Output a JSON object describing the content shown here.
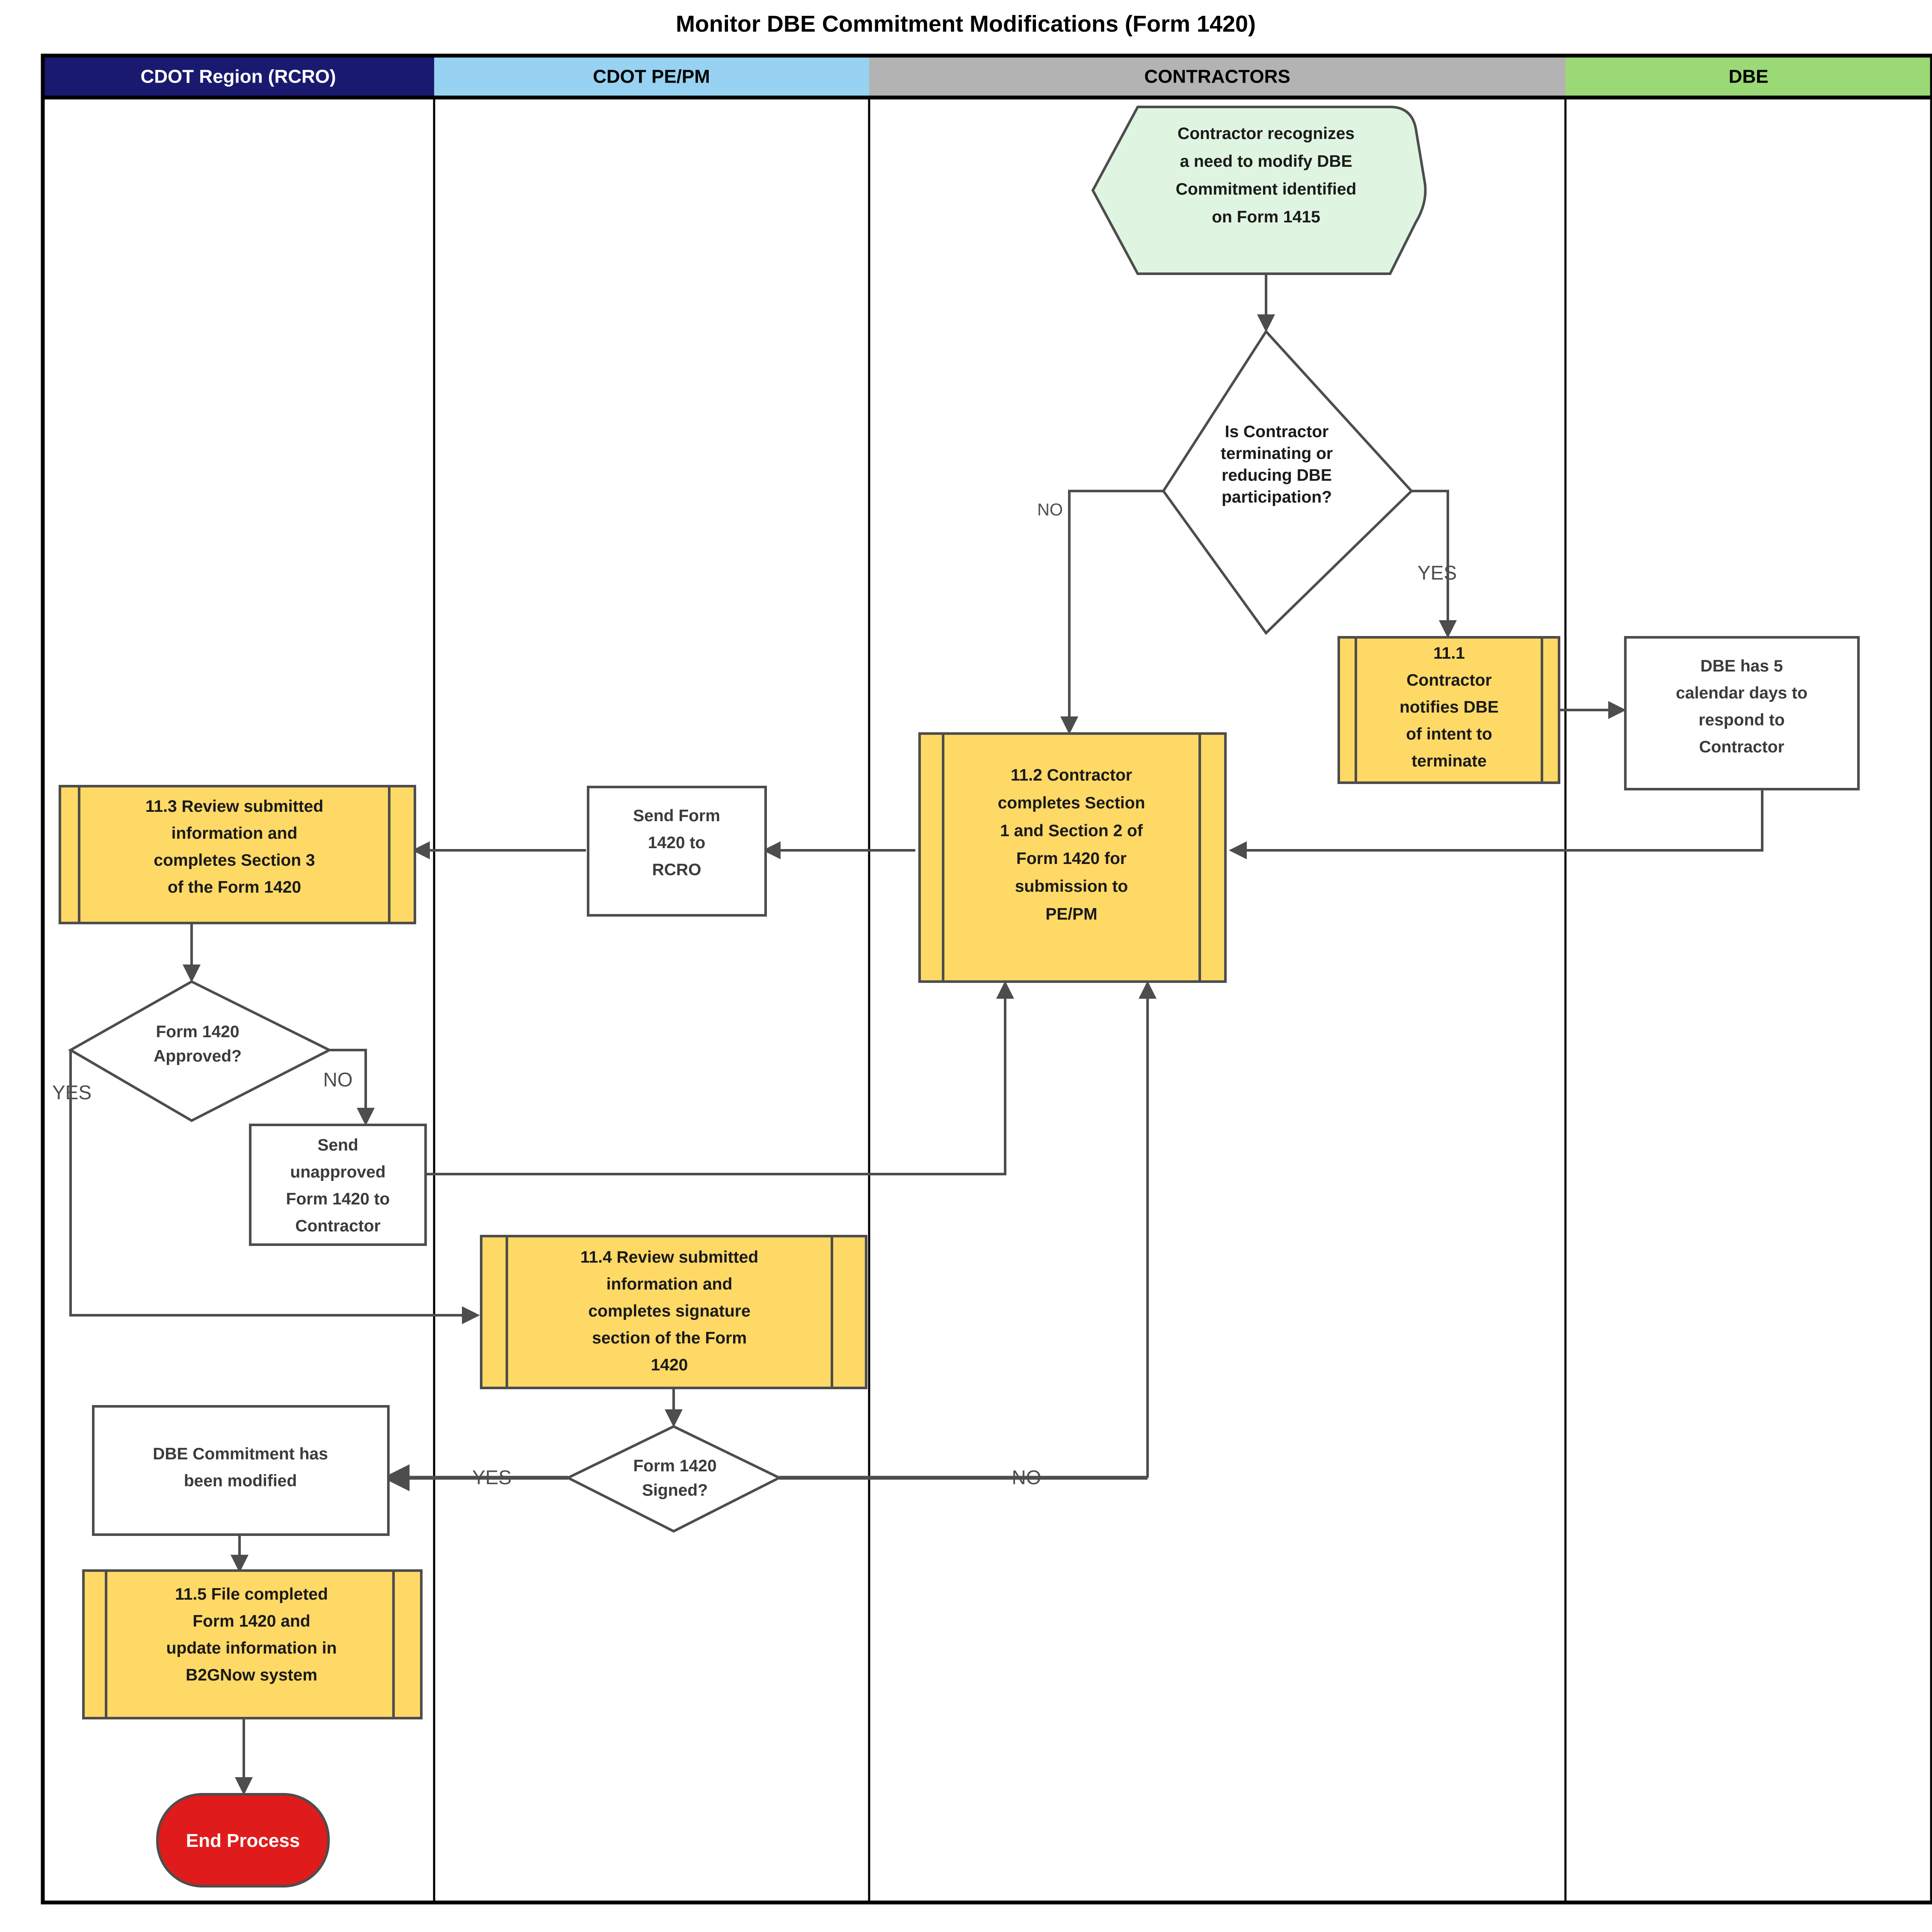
{
  "diagram": {
    "title": "Monitor DBE Commitment Modifications (Form 1420)",
    "lanes": [
      {
        "id": "rcro",
        "label": "CDOT Region (RCRO)",
        "fill": "#191970",
        "text_color": "#ffffff"
      },
      {
        "id": "pepm",
        "label": "CDOT PE/PM",
        "fill": "#97d2f2",
        "text_color": "#000000"
      },
      {
        "id": "contractors",
        "label": "CONTRACTORS",
        "fill": "#b3b3b3",
        "text_color": "#000000"
      },
      {
        "id": "dbe",
        "label": "DBE",
        "fill": "#9bd977",
        "text_color": "#000000"
      }
    ],
    "nodes": [
      {
        "id": "start",
        "lane": "contractors",
        "shape": "pentagon",
        "fill": "#dff5e1",
        "lines": [
          "Contractor recognizes",
          "a need to modify DBE",
          "Commitment identified",
          "on Form 1415"
        ]
      },
      {
        "id": "decision-terminating",
        "lane": "contractors",
        "shape": "diamond",
        "fill": "#ffffff",
        "lines": [
          "Is Contractor",
          "terminating or",
          "reducing DBE",
          "participation?"
        ]
      },
      {
        "id": "step-11-1",
        "lane": "contractors",
        "shape": "predefined-process",
        "fill": "#ffd966",
        "lines": [
          "11.1",
          "Contractor",
          "notifies DBE",
          "of intent to",
          "terminate"
        ]
      },
      {
        "id": "dbe-respond",
        "lane": "dbe",
        "shape": "rect",
        "fill": "#ffffff",
        "lines": [
          "DBE has 5",
          "calendar days to",
          "respond to",
          "Contractor"
        ]
      },
      {
        "id": "step-11-2",
        "lane": "contractors",
        "shape": "predefined-process",
        "fill": "#ffd966",
        "lines": [
          "11.2 Contractor",
          "completes Section",
          "1 and Section 2 of",
          "Form 1420 for",
          "submission to",
          "PE/PM"
        ]
      },
      {
        "id": "send-form-rcro",
        "lane": "pepm",
        "shape": "rect",
        "fill": "#ffffff",
        "lines": [
          "Send Form",
          "1420 to",
          "RCRO"
        ]
      },
      {
        "id": "step-11-3",
        "lane": "rcro",
        "shape": "predefined-process",
        "fill": "#ffd966",
        "lines": [
          "11.3 Review submitted",
          "information and",
          "completes Section 3",
          "of the Form 1420"
        ]
      },
      {
        "id": "decision-approved",
        "lane": "rcro",
        "shape": "diamond",
        "fill": "#ffffff",
        "lines": [
          "Form 1420",
          "Approved?"
        ]
      },
      {
        "id": "send-unapproved",
        "lane": "rcro",
        "shape": "rect",
        "fill": "#ffffff",
        "lines": [
          "Send",
          "unapproved",
          "Form 1420 to",
          "Contractor"
        ]
      },
      {
        "id": "step-11-4",
        "lane": "pepm",
        "shape": "predefined-process",
        "fill": "#ffd966",
        "lines": [
          "11.4 Review submitted",
          "information and",
          "completes signature",
          "section of the Form",
          "1420"
        ]
      },
      {
        "id": "decision-signed",
        "lane": "pepm",
        "shape": "diamond",
        "fill": "#ffffff",
        "lines": [
          "Form 1420",
          "Signed?"
        ]
      },
      {
        "id": "commitment-modified",
        "lane": "rcro",
        "shape": "rect",
        "fill": "#ffffff",
        "lines": [
          "DBE Commitment has",
          "been modified"
        ]
      },
      {
        "id": "step-11-5",
        "lane": "rcro",
        "shape": "predefined-process",
        "fill": "#ffd966",
        "lines": [
          "11.5 File completed",
          "Form 1420 and",
          "update information in",
          "B2GNow system"
        ]
      },
      {
        "id": "end",
        "lane": "rcro",
        "shape": "terminator",
        "fill": "#e01b1b",
        "lines": [
          "End Process"
        ]
      }
    ],
    "edge_labels": {
      "terminating_no": "NO",
      "terminating_yes": "YES",
      "approved_yes": "YES",
      "approved_no": "NO",
      "signed_yes": "YES",
      "signed_no": "NO"
    },
    "colors": {
      "accent_yellow": "#ffd966",
      "start_green": "#dff5e1",
      "end_red": "#e01b1b",
      "line": "#4d4d4d",
      "lane_border": "#000000"
    }
  }
}
